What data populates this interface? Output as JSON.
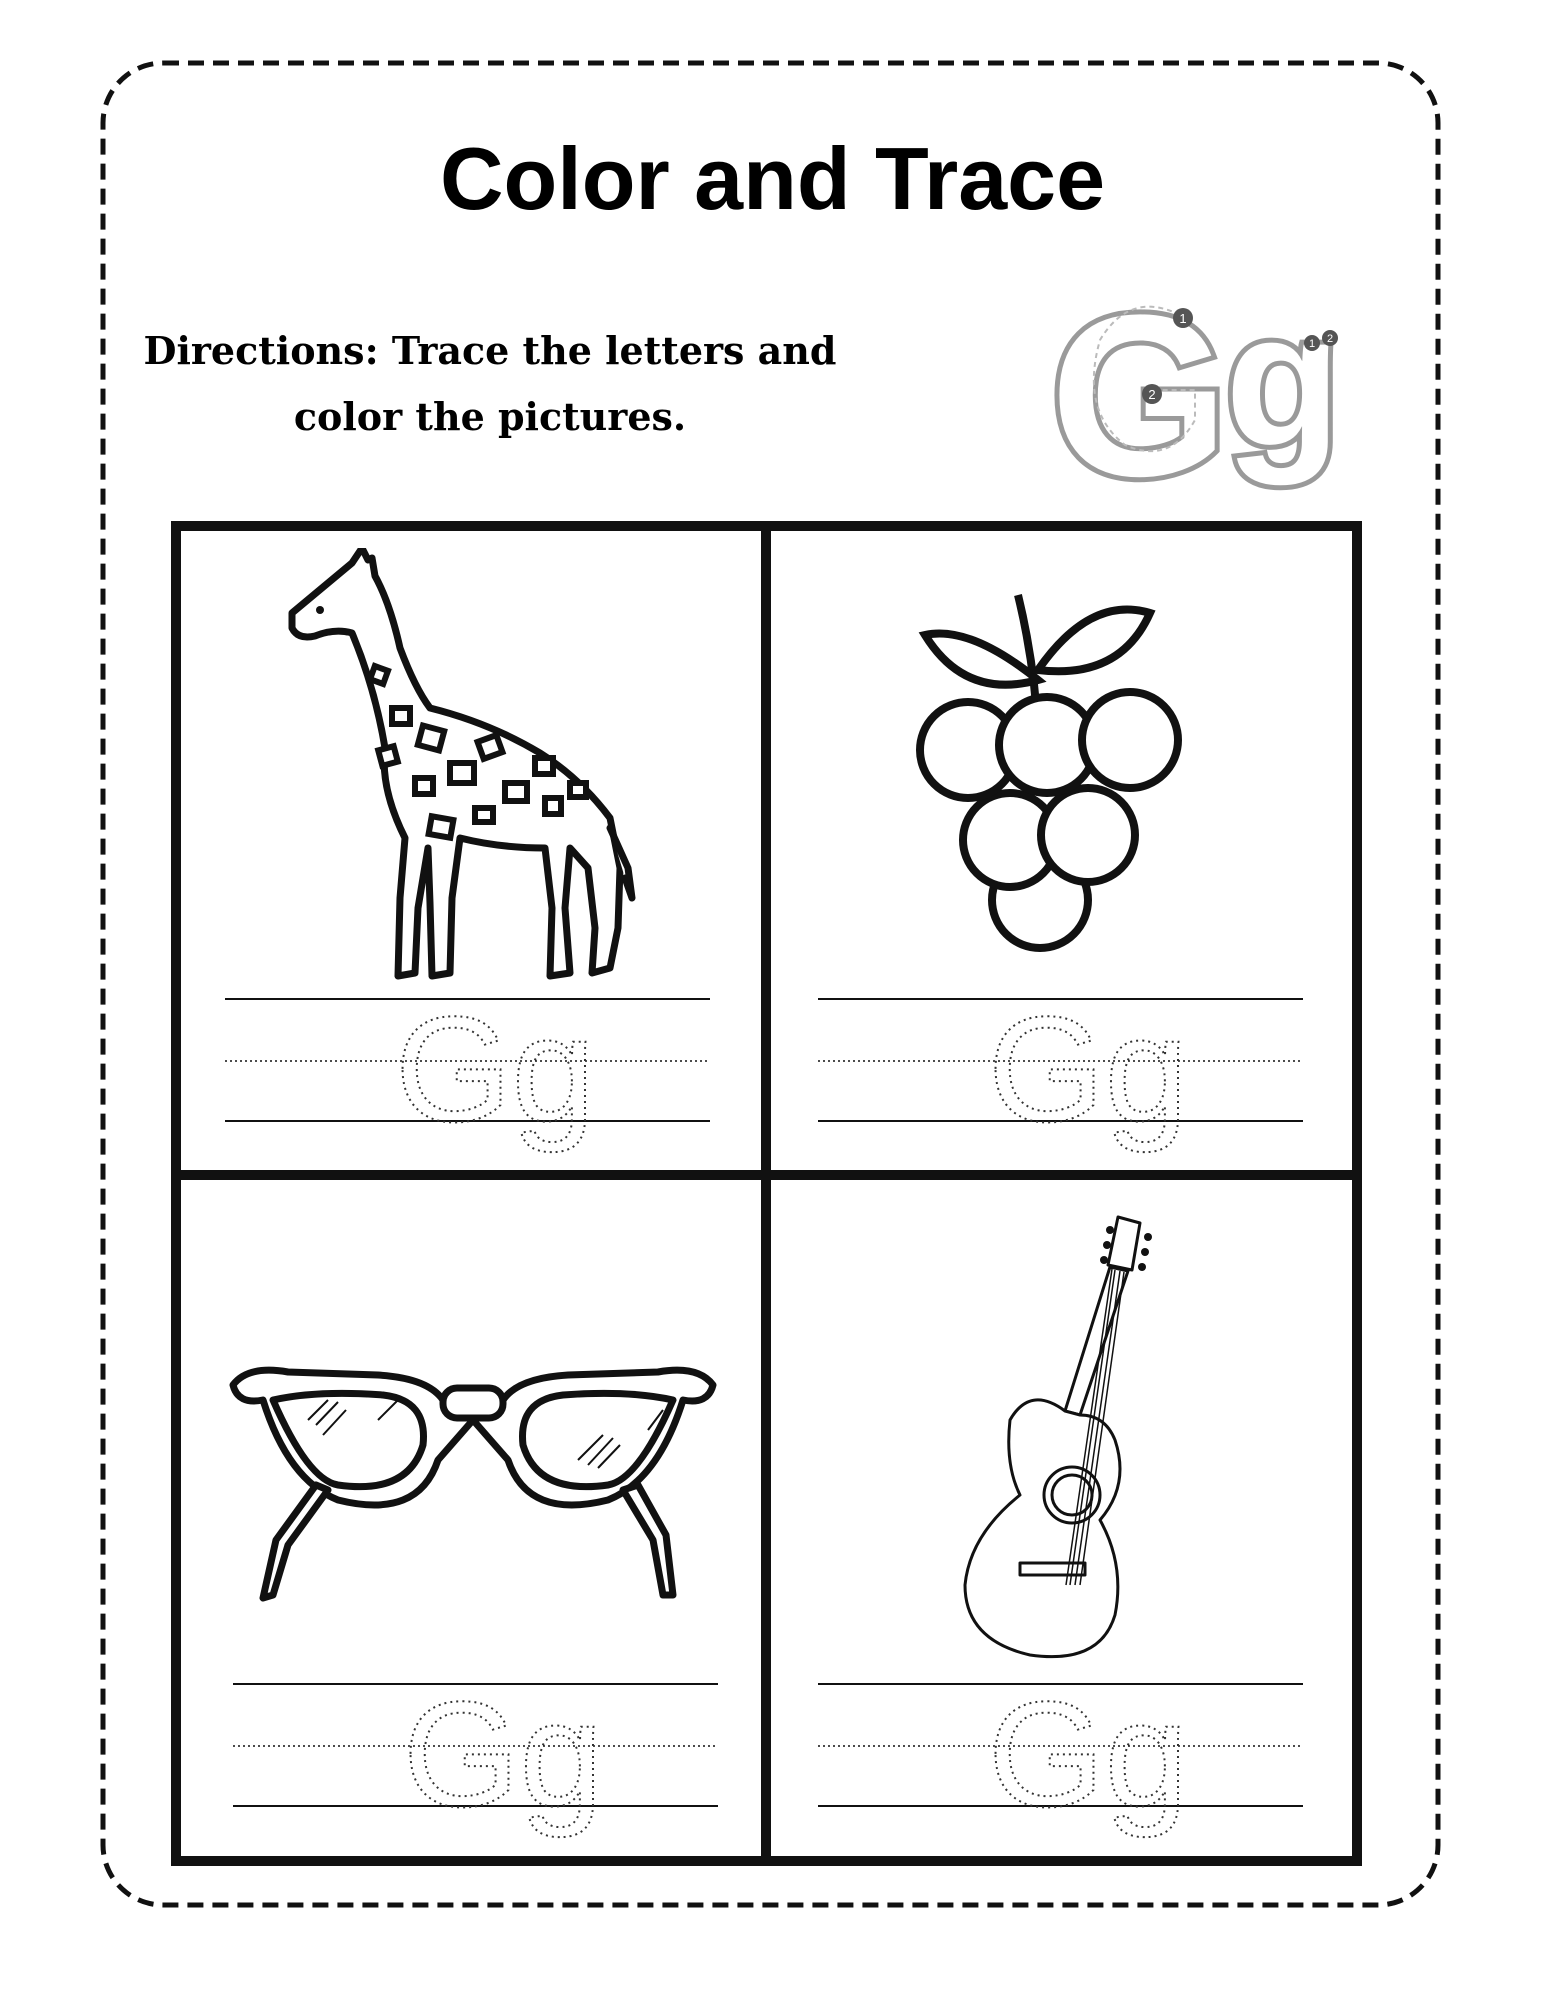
{
  "worksheet": {
    "title": "Color and Trace",
    "directions_line1": "Directions: Trace the letters and",
    "directions_line2": "color the pictures.",
    "letter": "Gg",
    "badge_steps": [
      "1",
      "2",
      "1",
      "2"
    ],
    "cells": [
      {
        "picture": "giraffe-icon",
        "trace_text": "Gg"
      },
      {
        "picture": "grapes-icon",
        "trace_text": "Gg"
      },
      {
        "picture": "glasses-icon",
        "trace_text": "Gg"
      },
      {
        "picture": "guitar-icon",
        "trace_text": "Gg"
      }
    ]
  }
}
